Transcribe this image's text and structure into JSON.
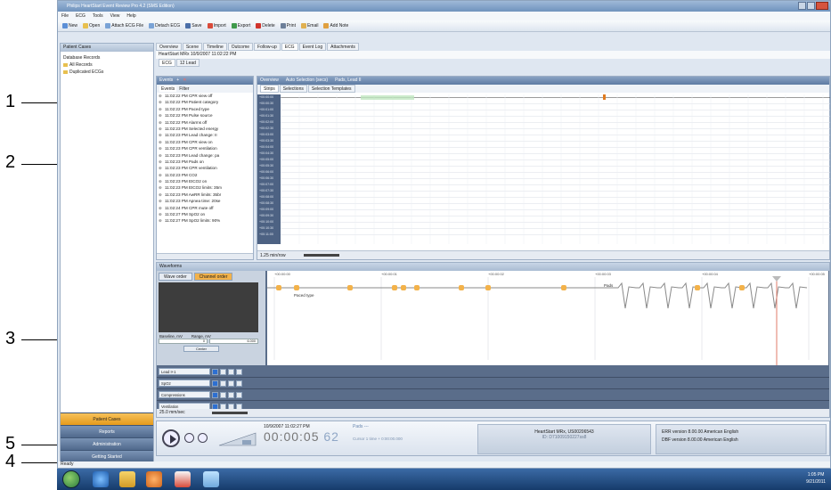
{
  "callouts": [
    {
      "num": "1"
    },
    {
      "num": "2"
    },
    {
      "num": "3"
    },
    {
      "num": "5"
    },
    {
      "num": "4"
    }
  ],
  "window": {
    "title": "Philips HeartStart Event Review Pro 4.2 (SMS Edition)"
  },
  "menu": [
    "File",
    "ECG",
    "Tools",
    "View",
    "Help"
  ],
  "toolbar": [
    {
      "label": "New",
      "icon": "new-icon",
      "color": "#5c8fd6"
    },
    {
      "label": "Open",
      "icon": "open-icon",
      "color": "#e8c04f"
    },
    {
      "label": "Attach ECG File",
      "icon": "attach-icon",
      "color": "#7aa3d6"
    },
    {
      "label": "Detach ECG",
      "icon": "detach-icon",
      "color": "#7aa3d6"
    },
    {
      "label": "Save",
      "icon": "save-icon",
      "color": "#4b6fa8"
    },
    {
      "label": "Import",
      "icon": "import-icon",
      "color": "#d94b3a"
    },
    {
      "label": "Export",
      "icon": "export-icon",
      "color": "#3f9a4b"
    },
    {
      "label": "Delete",
      "icon": "delete-icon",
      "color": "#d0342c"
    },
    {
      "label": "Print",
      "icon": "print-icon",
      "color": "#6c7f99"
    },
    {
      "label": "Email",
      "icon": "email-icon",
      "color": "#e0b050"
    },
    {
      "label": "Add Note",
      "icon": "note-icon",
      "color": "#e0a040"
    }
  ],
  "left_pane": {
    "header": "Patient Cases",
    "tree": [
      "Database Records",
      "All Records",
      "Duplicated ECGs"
    ],
    "nav": [
      "Patient Cases",
      "Reports",
      "Administration",
      "Getting Started"
    ]
  },
  "tabs": [
    "Overview",
    "Scene",
    "Timeline",
    "Outcome",
    "Follow-up",
    "ECG",
    "Event Log",
    "Attachments"
  ],
  "device_header": "HeartStart MRx 10/9/2007 11:02:22 PM",
  "ecg_tabs": [
    "ECG",
    "12 Lead"
  ],
  "events": {
    "header": "Events",
    "filter_tabs": [
      "Events",
      "Filter"
    ],
    "rows": [
      "11:02:22 PM CPR view off",
      "11:02:22 PM Patient category",
      "11:02:22 PM Paced type",
      "11:02:22 PM Pulse source",
      "11:02:22 PM Alarms off",
      "11:02:23 PM Selected energy",
      "11:02:23 PM Lead change: II",
      "11:02:23 PM CPR view on",
      "11:02:23 PM CPR ventilation",
      "11:02:23 PM Lead change: pa",
      "11:02:23 PM Pads on",
      "11:02:23 PM CPR ventilation",
      "11:02:23 PM CO2",
      "11:02:23 PM EtCO2 on",
      "11:02:23 PM EtCO2 limits: 35m",
      "11:02:23 PM AwRR limits: 35br",
      "11:02:23 PM Apnea time: 20se",
      "11:02:24 PM CPR mute off",
      "11:02:27 PM SpO2 on",
      "11:02:27 PM SpO2 limits: 90%"
    ]
  },
  "overview": {
    "header": "Overview",
    "selection": "Auto Selection (secs)",
    "lead": "Pads, Lead II",
    "tabs": [
      "Strips",
      "Selections",
      "Selection Templates"
    ],
    "times": [
      "+00:00:00",
      "+00:00:30",
      "+00:01:00",
      "+00:01:30",
      "+00:02:00",
      "+00:02:30",
      "+00:03:00",
      "+00:03:30",
      "+00:04:00",
      "+00:04:30",
      "+00:05:00",
      "+00:05:30",
      "+00:06:00",
      "+00:06:30",
      "+00:07:00",
      "+00:07:30",
      "+00:08:00",
      "+00:08:30",
      "+00:09:00",
      "+00:09:30",
      "+00:10:00",
      "+00:10:30",
      "+00:11:00"
    ],
    "minutes": "1.25 min/row"
  },
  "waveforms": {
    "header": "Waveforms",
    "order_buttons": [
      "Wave order",
      "Channel order"
    ],
    "baseline_label": "Baseline, mV",
    "range_label": "Range, mV",
    "baseline_value": "0",
    "range_value": "6.000",
    "center_label": "Center",
    "time_marks": [
      "+00:00:00",
      "+00:00:01",
      "+00:00:02",
      "+00:00:03",
      "+00:00:04",
      "+00:00:05"
    ],
    "annotation_paced": "Paced type",
    "annotation_pads": "Pads",
    "leads": [
      "Lead I+1",
      "SpO2",
      "Compressions",
      "Ventilation"
    ],
    "speed": "25.0 mm/sec"
  },
  "player": {
    "date": "10/9/2007 11:02:27 PM",
    "time_main": "00:00:05",
    "time_frac": "62",
    "channel": "Pads",
    "channel_value": "---",
    "cursor_label": "Cursor 1 time",
    "cursor_value": "+ 0:00:00.000",
    "device": "HeartStart MRx, US00206543",
    "device_id": "ID: D71009150227ss8",
    "ver1": "ERR version 8.00.00 American English",
    "ver2": "DBF version 8.00.00 American English",
    "status": "Ready"
  },
  "tray": {
    "time": "1:05 PM",
    "date": "9/21/2011"
  }
}
